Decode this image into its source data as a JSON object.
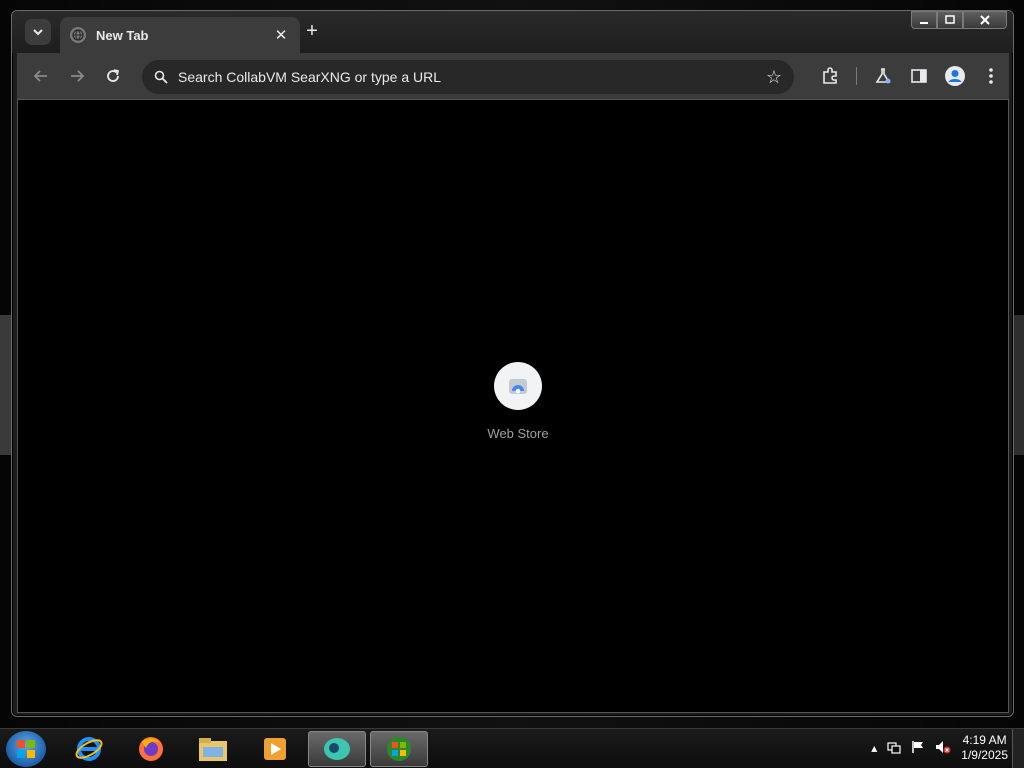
{
  "tab": {
    "title": "New Tab",
    "close_label": "✕"
  },
  "toolbar": {
    "new_tab_label": "+",
    "omnibox_placeholder": "Search CollabVM SearXNG or type a URL"
  },
  "shortcuts": [
    {
      "label": "Web Store",
      "icon": "web-store-icon"
    }
  ],
  "taskbar": {
    "apps": [
      "start-orb",
      "internet-explorer-icon",
      "firefox-icon",
      "file-explorer-icon",
      "media-player-icon",
      "chrome-dev-icon",
      "windows-update-icon"
    ],
    "clock_time": "4:19 AM",
    "clock_date": "1/9/2025"
  },
  "colors": {
    "toolbar": "#3c3c3c",
    "content_bg": "#000000",
    "accent": "#8ab4f8"
  }
}
